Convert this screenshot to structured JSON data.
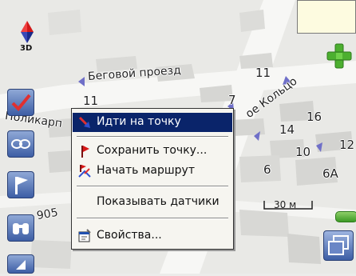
{
  "map": {
    "street_labels": {
      "begovoy": "Беговой проезд",
      "koltso": "ое Кольцо",
      "polikarp": "Поликарп",
      "left_905": "905"
    },
    "house_numbers": {
      "n11_top": "11",
      "n11_left": "11",
      "n7": "7",
      "n16": "16",
      "n14": "14",
      "n12": "12",
      "n10": "10",
      "n6": "6",
      "n6a": "6А"
    },
    "mode_label": "3D",
    "scale_label": "30 м"
  },
  "context_menu": {
    "items": [
      {
        "label": "Идти на точку",
        "icon": "go-to-point-icon",
        "selected": true
      },
      {
        "label": "Сохранить точку...",
        "icon": "red-flag-icon",
        "selected": false
      },
      {
        "label": "Начать маршрут",
        "icon": "route-start-icon",
        "selected": false
      },
      {
        "label": "Показывать датчики",
        "icon": "",
        "selected": false
      },
      {
        "label": "Свойства...",
        "icon": "properties-icon",
        "selected": false
      }
    ]
  },
  "colors": {
    "menu_highlight": "#0a246a",
    "menu_background": "#f6f5f0",
    "sidebar_button": "#3d5ea5",
    "zoom_green": "#3c9a25",
    "route_purple": "#6f6fc8"
  }
}
